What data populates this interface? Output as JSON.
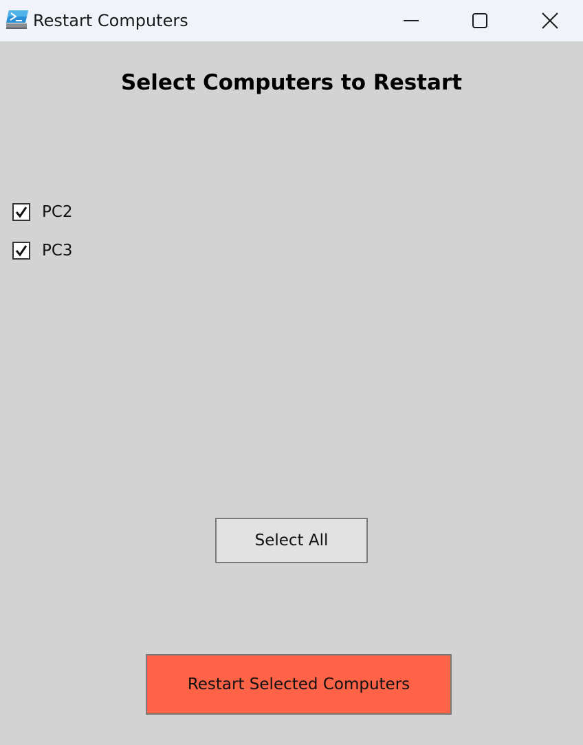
{
  "window": {
    "title": "Restart Computers",
    "controls": {
      "minimize_icon": "minimize-icon",
      "maximize_icon": "maximize-icon",
      "close_icon": "close-icon"
    }
  },
  "main": {
    "heading": "Select Computers to Restart",
    "computers": [
      {
        "label": "PC2",
        "checked": true
      },
      {
        "label": "PC3",
        "checked": true
      }
    ],
    "select_all_label": "Select All",
    "restart_label": "Restart Selected Computers"
  },
  "colors": {
    "background": "#d3d3d3",
    "titlebar": "#f0f3f9",
    "restart_button": "#ff6347",
    "select_all_button": "#e2e2e2"
  }
}
